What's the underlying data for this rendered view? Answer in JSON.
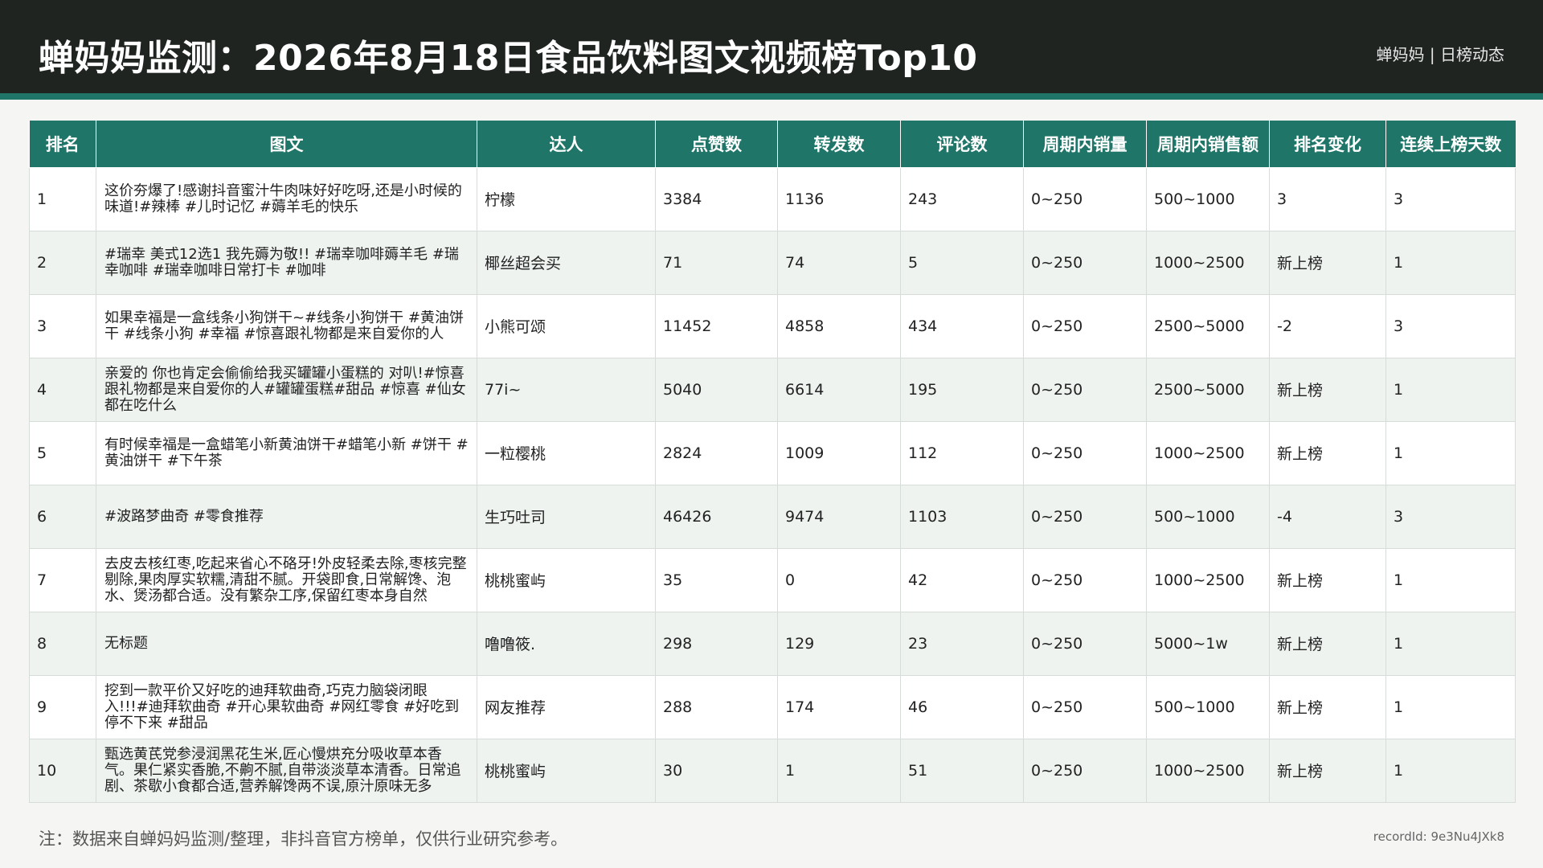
{
  "header": {
    "title": "蝉妈妈监测：2026年8月18日食品饮料图文视频榜Top10",
    "brand": "蝉妈妈 | 日榜动态"
  },
  "table": {
    "columns": [
      "排名",
      "图文",
      "达人",
      "点赞数",
      "转发数",
      "评论数",
      "周期内销量",
      "周期内销售额",
      "排名变化",
      "连续上榜天数"
    ],
    "rows": [
      {
        "rank": "1",
        "post": "这价夯爆了!感谢抖音蜜汁牛肉味好好吃呀,还是小时候的味道!#辣棒 #儿时记忆 #薅羊毛的快乐",
        "creator": "柠檬",
        "likes": "3384",
        "shares": "1136",
        "comments": "243",
        "volume": "0~250",
        "sales": "500~1000",
        "change": "3",
        "days": "3"
      },
      {
        "rank": "2",
        "post": "#瑞幸 美式12选1 我先薅为敬!! #瑞幸咖啡薅羊毛 #瑞幸咖啡 #瑞幸咖啡日常打卡 #咖啡",
        "creator": "椰丝超会买",
        "likes": "71",
        "shares": "74",
        "comments": "5",
        "volume": "0~250",
        "sales": "1000~2500",
        "change": "新上榜",
        "days": "1"
      },
      {
        "rank": "3",
        "post": "如果幸福是一盒线条小狗饼干~#线条小狗饼干 #黄油饼干 #线条小狗 #幸福 #惊喜跟礼物都是来自爱你的人",
        "creator": "小熊可颂",
        "likes": "11452",
        "shares": "4858",
        "comments": "434",
        "volume": "0~250",
        "sales": "2500~5000",
        "change": "-2",
        "days": "3"
      },
      {
        "rank": "4",
        "post": "亲爱的 你也肯定会偷偷给我买罐罐小蛋糕的 对叭!#惊喜跟礼物都是来自爱你的人#罐罐蛋糕#甜品 #惊喜 #仙女都在吃什么",
        "creator": "77i~",
        "likes": "5040",
        "shares": "6614",
        "comments": "195",
        "volume": "0~250",
        "sales": "2500~5000",
        "change": "新上榜",
        "days": "1"
      },
      {
        "rank": "5",
        "post": "有时候幸福是一盒蜡笔小新黄油饼干#蜡笔小新 #饼干 #黄油饼干 #下午茶",
        "creator": "一粒樱桃",
        "likes": "2824",
        "shares": "1009",
        "comments": "112",
        "volume": "0~250",
        "sales": "1000~2500",
        "change": "新上榜",
        "days": "1"
      },
      {
        "rank": "6",
        "post": "#波路梦曲奇 #零食推荐",
        "creator": "生巧吐司",
        "likes": "46426",
        "shares": "9474",
        "comments": "1103",
        "volume": "0~250",
        "sales": "500~1000",
        "change": "-4",
        "days": "3"
      },
      {
        "rank": "7",
        "post": "去皮去核红枣,吃起来省心不硌牙!外皮轻柔去除,枣核完整剔除,果肉厚实软糯,清甜不腻。开袋即食,日常解馋、泡水、煲汤都合适。没有繁杂工序,保留红枣本身自然",
        "creator": "桃桃蜜屿",
        "likes": "35",
        "shares": "0",
        "comments": "42",
        "volume": "0~250",
        "sales": "1000~2500",
        "change": "新上榜",
        "days": "1"
      },
      {
        "rank": "8",
        "post": "无标题",
        "creator": "噜噜筱.󠀠",
        "likes": "298",
        "shares": "129",
        "comments": "23",
        "volume": "0~250",
        "sales": "5000~1w",
        "change": "新上榜",
        "days": "1"
      },
      {
        "rank": "9",
        "post": "挖到一款平价又好吃的迪拜软曲奇,巧克力脑袋闭眼入!!!#迪拜软曲奇 #开心果软曲奇 #网红零食 #好吃到停不下来 #甜品",
        "creator": "网友推荐",
        "likes": "288",
        "shares": "174",
        "comments": "46",
        "volume": "0~250",
        "sales": "500~1000",
        "change": "新上榜",
        "days": "1"
      },
      {
        "rank": "10",
        "post": "甄选黄芪党参浸润黑花生米,匠心慢烘充分吸收草本香气。果仁紧实香脆,不齁不腻,自带淡淡草本清香。日常追剧、茶歇小食都合适,营养解馋两不误,原汁原味无多",
        "creator": "桃桃蜜屿",
        "likes": "30",
        "shares": "1",
        "comments": "51",
        "volume": "0~250",
        "sales": "1000~2500",
        "change": "新上榜",
        "days": "1"
      }
    ]
  },
  "footer": {
    "note": "注：数据来自蝉妈妈监测/整理，非抖音官方榜单，仅供行业研究参考。",
    "record": "recordId: 9e3Nu4JXk8"
  }
}
